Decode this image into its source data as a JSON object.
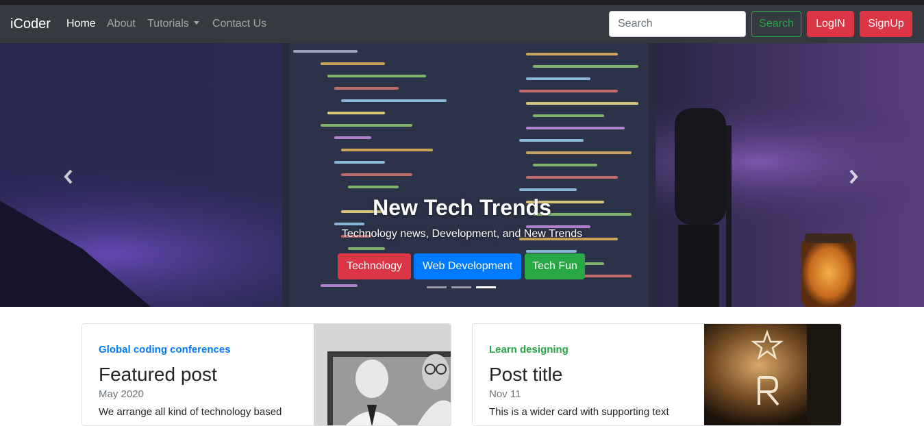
{
  "navbar": {
    "brand": "iCoder",
    "links": [
      {
        "label": "Home"
      },
      {
        "label": "About"
      },
      {
        "label": "Tutorials"
      },
      {
        "label": "Contact Us"
      }
    ],
    "search_placeholder": "Search",
    "search_button": "Search",
    "login_button": "LogIN",
    "signup_button": "SignUp"
  },
  "carousel": {
    "title": "New Tech Trends",
    "subtitle": "Technology news, Development, and New Trends",
    "buttons": [
      {
        "label": "Technology",
        "color": "#dc3545"
      },
      {
        "label": "Web Development",
        "color": "#007bff"
      },
      {
        "label": "Tech Fun",
        "color": "#28a745"
      }
    ],
    "active_slide": 3,
    "slide_count": 3
  },
  "cards": [
    {
      "category": "Global coding conferences",
      "category_color": "#007bff",
      "title": "Featured post",
      "date": "May 2020",
      "text": "We arrange all kind of technology based"
    },
    {
      "category": "Learn designing",
      "category_color": "#28a745",
      "title": "Post title",
      "date": "Nov 11",
      "text": "This is a wider card with supporting text"
    }
  ],
  "colors": {
    "navbar_bg": "#343a40",
    "danger": "#dc3545",
    "primary": "#007bff",
    "success": "#28a745"
  }
}
